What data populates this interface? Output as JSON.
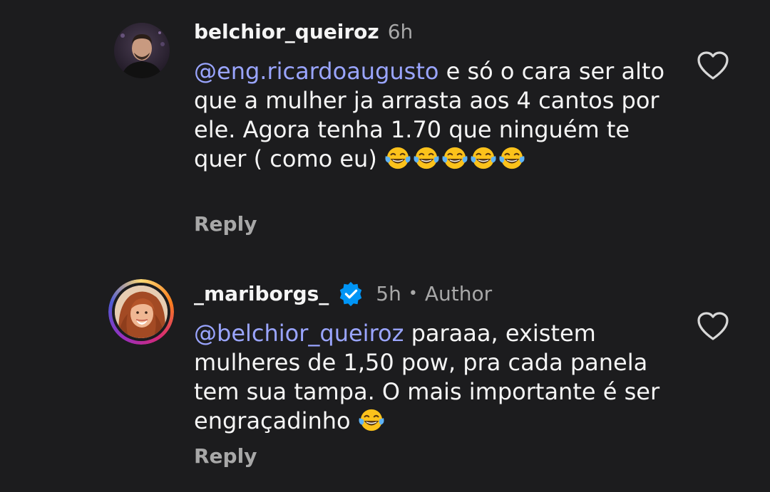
{
  "comments": [
    {
      "username": "belchior_queiroz",
      "time": "6h",
      "mention": "@eng.ricardoaugusto",
      "text_line_1": " e só o cara ser",
      "text_rest": "alto que a mulher ja arrasta aos 4 cantos por ele. Agora tenha 1.70 que ninguém te quer ( como eu) ",
      "emoji_count": 5,
      "reply_label": "Reply",
      "avatar_icon": "man-profile-photo",
      "like_icon": "heart-outline-icon"
    },
    {
      "username": "_mariborgs_",
      "verified_icon": "verified-badge-icon",
      "time": "5h",
      "separator": "•",
      "author_label": "Author",
      "mention": "@belchior_queiroz",
      "text_line_1": " paraaa, existem",
      "text_rest": "mulheres de 1,50 pow, pra cada panela tem sua tampa. O mais importante é ser engraçadinho ",
      "emoji_count": 1,
      "reply_label": "Reply",
      "avatar_icon": "woman-profile-photo-story-ring",
      "like_icon": "heart-outline-icon"
    }
  ],
  "colors": {
    "background": "#1c1c1e",
    "text": "#f5f5f5",
    "muted": "#a8a8a8",
    "mention": "#9aa5ff",
    "verified": "#0095f6"
  }
}
